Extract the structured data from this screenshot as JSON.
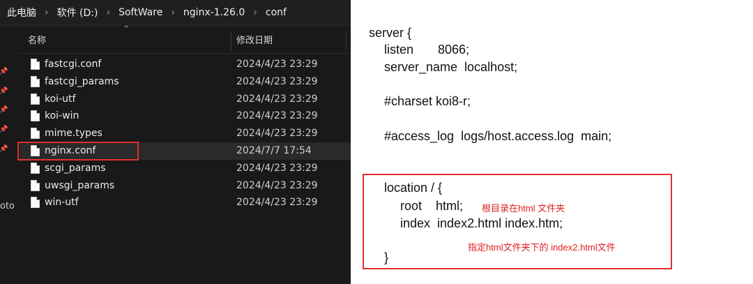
{
  "explorer": {
    "breadcrumb": [
      "此电脑",
      "软件 (D:)",
      "SoftWare",
      "nginx-1.26.0",
      "conf"
    ],
    "breadcrumb_separator": "›",
    "columns": {
      "name": "名称",
      "date": "修改日期"
    },
    "sidebar_fragment": "oto",
    "files": [
      {
        "name": "fastcgi.conf",
        "date": "2024/4/23 23:29"
      },
      {
        "name": "fastcgi_params",
        "date": "2024/4/23 23:29"
      },
      {
        "name": "koi-utf",
        "date": "2024/4/23 23:29"
      },
      {
        "name": "koi-win",
        "date": "2024/4/23 23:29"
      },
      {
        "name": "mime.types",
        "date": "2024/4/23 23:29"
      },
      {
        "name": "nginx.conf",
        "date": "2024/7/7 17:54"
      },
      {
        "name": "scgi_params",
        "date": "2024/4/23 23:29"
      },
      {
        "name": "uwsgi_params",
        "date": "2024/4/23 23:29"
      },
      {
        "name": "win-utf",
        "date": "2024/4/23 23:29"
      }
    ]
  },
  "config": {
    "lines": [
      "server {",
      "listen       8066;",
      "server_name  localhost;",
      "#charset koi8-r;",
      "#access_log  logs/host.access.log  main;",
      "location / {",
      "root    html;",
      "index  index2.html index.htm;",
      "}"
    ],
    "notes": {
      "root": "根目录在html 文件夹",
      "index": "指定html文件夹下的 index2.html文件"
    }
  },
  "colors": {
    "highlight": "#e03030",
    "note": "#e02020",
    "explorer_bg": "#191919"
  }
}
